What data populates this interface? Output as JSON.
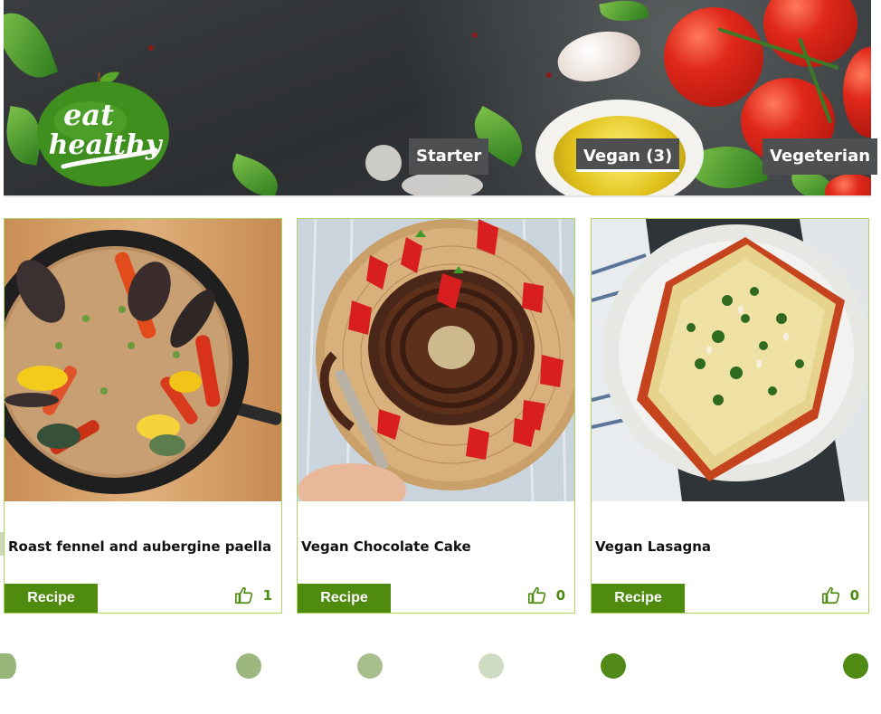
{
  "header": {
    "logo_text_line1": "eat",
    "logo_text_line2": "healthy",
    "nav": [
      {
        "label": "Starter",
        "active": false
      },
      {
        "label": "Vegan (3)",
        "active": true
      },
      {
        "label": "Vegeterian",
        "active": false
      }
    ]
  },
  "recipes": [
    {
      "title": "Roast fennel and aubergine paella",
      "button": "Recipe",
      "likes": "1",
      "image": "paella-pan-photo"
    },
    {
      "title": "Vegan Chocolate Cake",
      "button": "Recipe",
      "likes": "0",
      "image": "chocolate-bundt-cake-photo"
    },
    {
      "title": "Vegan Lasagna",
      "button": "Recipe",
      "likes": "0",
      "image": "lasagna-plate-photo"
    }
  ],
  "colors": {
    "accent_green": "#4e8b0f",
    "card_border": "#a9d45f",
    "nav_bg": "#4e4f50"
  },
  "icons": {
    "like": "thumbs-up-icon",
    "logo": "apple-logo-icon"
  }
}
